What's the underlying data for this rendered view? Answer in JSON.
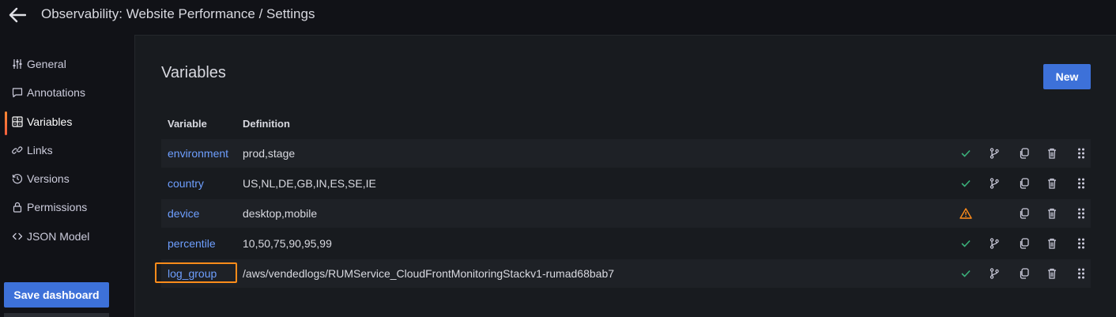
{
  "header": {
    "title": "Observability: Website Performance / Settings"
  },
  "sidebar": {
    "items": [
      {
        "label": "General",
        "icon": "sliders-icon"
      },
      {
        "label": "Annotations",
        "icon": "comment-icon"
      },
      {
        "label": "Variables",
        "icon": "calculator-icon",
        "active": true
      },
      {
        "label": "Links",
        "icon": "link-icon"
      },
      {
        "label": "Versions",
        "icon": "history-icon"
      },
      {
        "label": "Permissions",
        "icon": "lock-icon"
      },
      {
        "label": "JSON Model",
        "icon": "code-icon"
      }
    ],
    "save_label": "Save dashboard"
  },
  "main": {
    "title": "Variables",
    "new_label": "New",
    "columns": [
      "Variable",
      "Definition"
    ],
    "rows": [
      {
        "name": "environment",
        "definition": "prod,stage",
        "status": "ok"
      },
      {
        "name": "country",
        "definition": "US,NL,DE,GB,IN,ES,SE,IE",
        "status": "ok"
      },
      {
        "name": "device",
        "definition": "desktop,mobile",
        "status": "warning"
      },
      {
        "name": "percentile",
        "definition": "10,50,75,90,95,99",
        "status": "ok"
      },
      {
        "name": "log_group",
        "definition": "/aws/vendedlogs/RUMService_CloudFrontMonitoringStackv1-rumad68bab7",
        "status": "ok",
        "highlighted": true
      }
    ]
  },
  "colors": {
    "accent_blue": "#3d71d9",
    "link_blue": "#6e9fff",
    "ok_green": "#3bb07a",
    "warn_orange": "#ff8c1a",
    "highlight_orange": "#ff8c1a"
  }
}
